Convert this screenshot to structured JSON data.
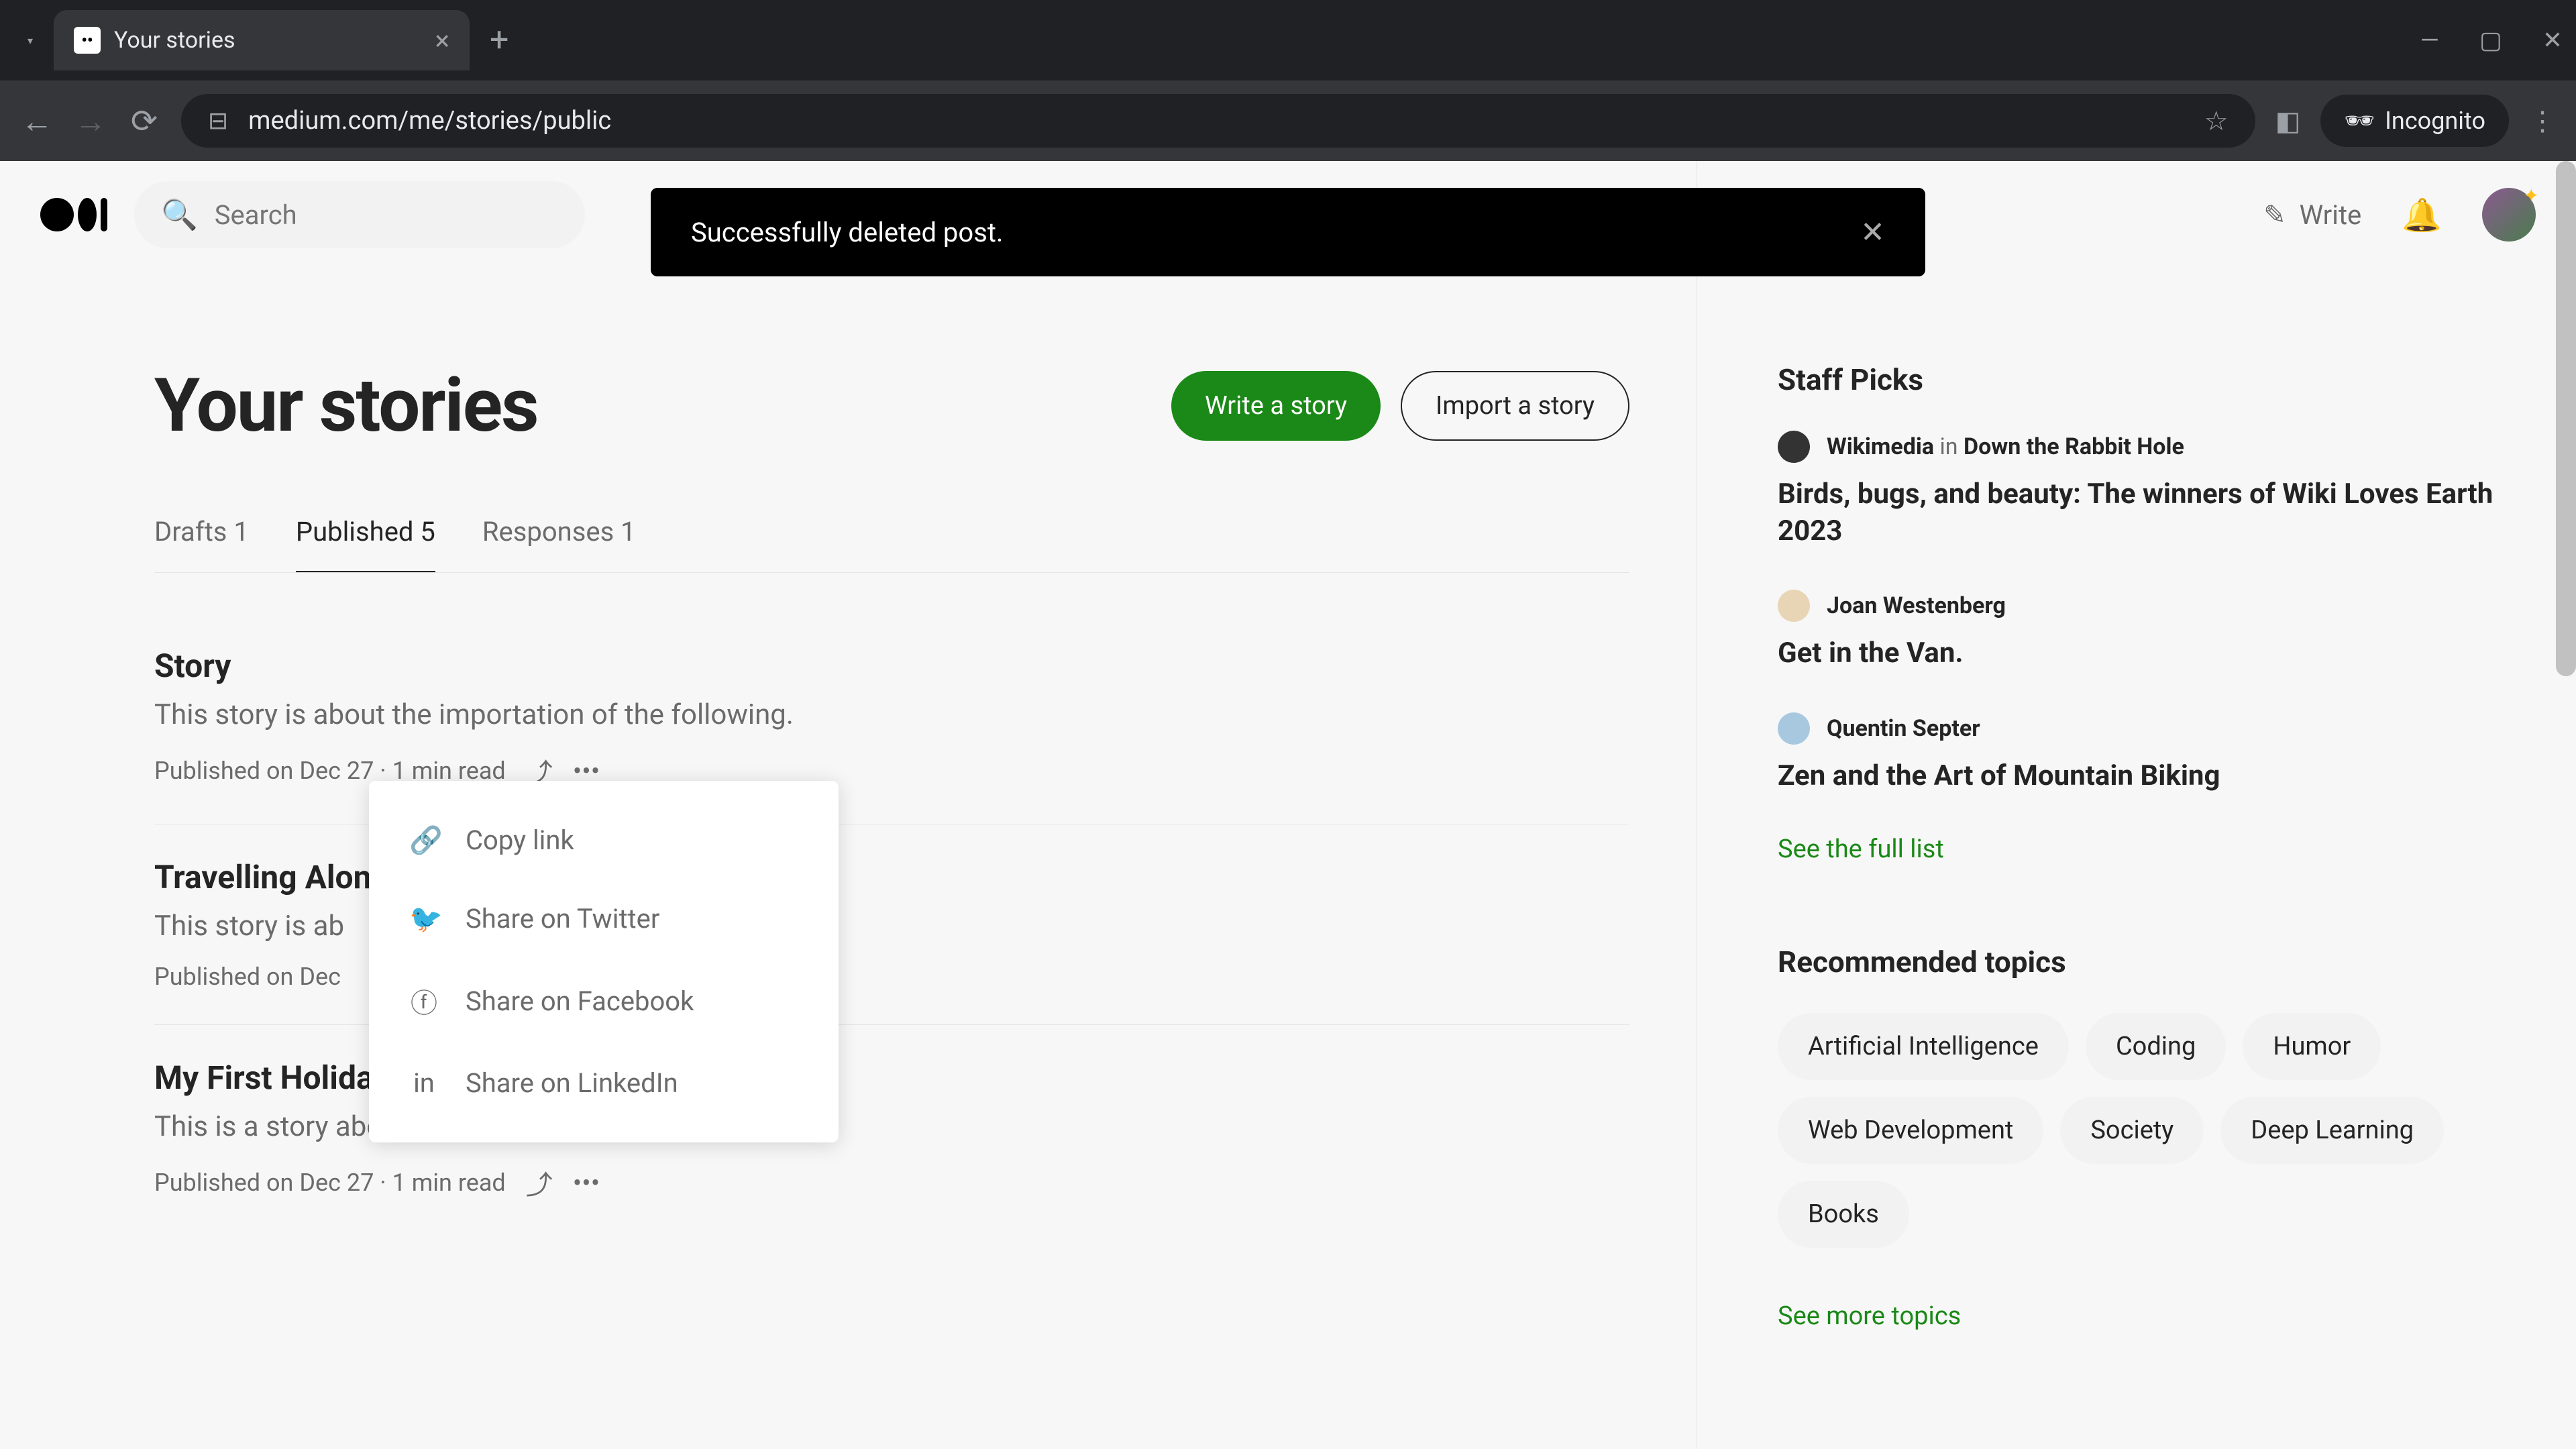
{
  "browser": {
    "tab_title": "Your stories",
    "url": "medium.com/me/stories/public",
    "incognito_label": "Incognito"
  },
  "topbar": {
    "search_placeholder": "Search",
    "write_label": "Write"
  },
  "toast": {
    "message": "Successfully deleted post."
  },
  "header": {
    "title": "Your stories",
    "write_story": "Write a story",
    "import_story": "Import a story"
  },
  "tabs": [
    {
      "label": "Drafts 1"
    },
    {
      "label": "Published 5"
    },
    {
      "label": "Responses 1"
    }
  ],
  "stories": [
    {
      "title": "Story",
      "desc": "This story is about the importation of the following.",
      "meta": "Published on Dec 27 · 1 min read"
    },
    {
      "title": "Travelling Alon",
      "desc": "This story is ab                                                    tion here",
      "meta": "Published on Dec"
    },
    {
      "title": "My First Holida",
      "desc": "This is a story about a holiday",
      "meta": "Published on Dec 27 · 1 min read"
    }
  ],
  "share_menu": {
    "copy": "Copy link",
    "twitter": "Share on Twitter",
    "facebook": "Share on Facebook",
    "linkedin": "Share on LinkedIn"
  },
  "sidebar": {
    "staff_heading": "Staff Picks",
    "picks": [
      {
        "author": "Wikimedia",
        "in": " in ",
        "pub": "Down the Rabbit Hole",
        "title": "Birds, bugs, and beauty: The winners of Wiki Loves Earth 2023"
      },
      {
        "author": "Joan Westenberg",
        "in": "",
        "pub": "",
        "title": "Get in the Van."
      },
      {
        "author": "Quentin Septer",
        "in": "",
        "pub": "",
        "title": "Zen and the Art of Mountain Biking"
      }
    ],
    "see_full": "See the full list",
    "topics_heading": "Recommended topics",
    "topics": [
      "Artificial Intelligence",
      "Coding",
      "Humor",
      "Web Development",
      "Society",
      "Deep Learning",
      "Books"
    ],
    "see_more": "See more topics"
  }
}
